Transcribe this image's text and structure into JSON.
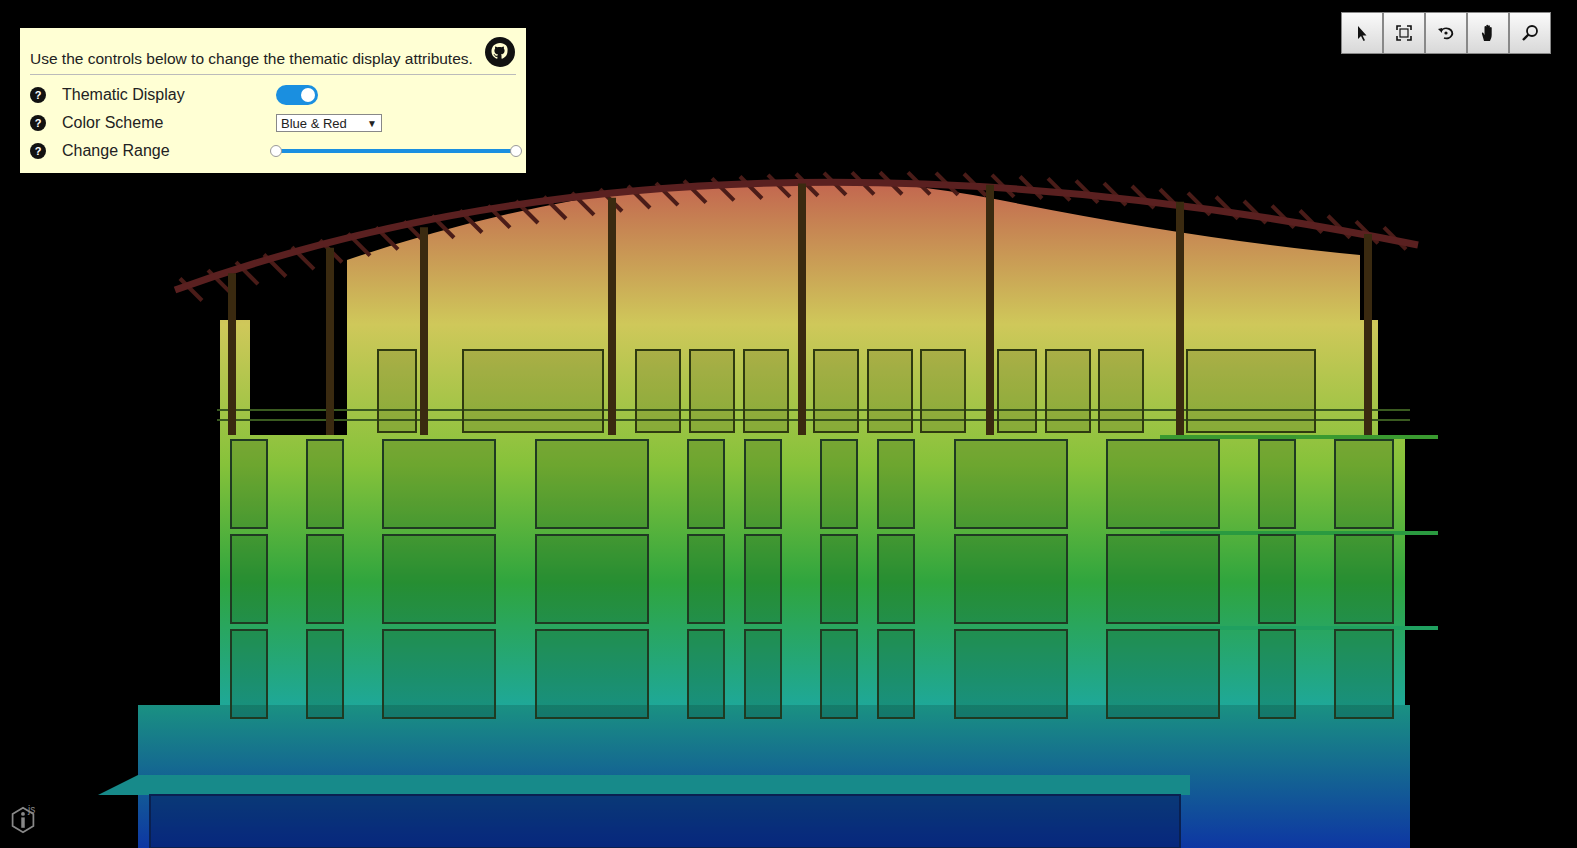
{
  "panel": {
    "intro": "Use the controls below to change the thematic display attributes.",
    "controls": [
      {
        "kind": "toggle",
        "help": "?",
        "label": "Thematic Display",
        "on": true
      },
      {
        "kind": "select",
        "help": "?",
        "label": "Color Scheme",
        "value": "Blue & Red",
        "caret": "▼"
      },
      {
        "kind": "range",
        "help": "?",
        "label": "Change Range",
        "level": 1
      }
    ]
  },
  "toolbar": {
    "tools": [
      {
        "kind": "select",
        "selected": false
      },
      {
        "kind": "fit",
        "selected": false
      },
      {
        "kind": "rotate",
        "selected": false
      },
      {
        "kind": "pan",
        "selected": false
      },
      {
        "kind": "zoom",
        "selected": false
      }
    ]
  },
  "logo": {
    "text": "js"
  }
}
